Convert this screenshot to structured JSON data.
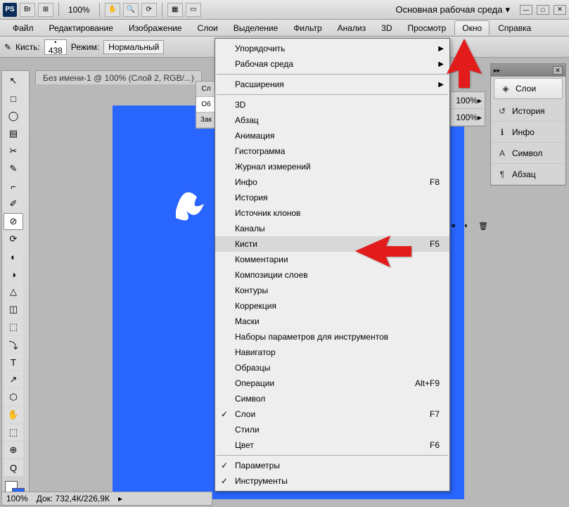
{
  "top": {
    "ps_abbr": "PS",
    "zoom": "100%",
    "workspace_label": "Основная рабочая среда"
  },
  "menus": [
    "Файл",
    "Редактирование",
    "Изображение",
    "Слои",
    "Выделение",
    "Фильтр",
    "Анализ",
    "3D",
    "Просмотр",
    "Окно",
    "Справка"
  ],
  "active_menu_index": 9,
  "options": {
    "brush_label": "Кисть:",
    "brush_size": "438",
    "mode_label": "Режим:",
    "mode_value": "Нормальный"
  },
  "doc_tab": "Без имени-1 @ 100% (Слой 2, RGB/...)",
  "status": {
    "zoom": "100%",
    "doc": "Док: 732,4К/226,9К"
  },
  "dropdown": [
    {
      "type": "item",
      "label": "Упорядочить",
      "submenu": true
    },
    {
      "type": "item",
      "label": "Рабочая среда",
      "submenu": true
    },
    {
      "type": "sep"
    },
    {
      "type": "item",
      "label": "Расширения",
      "submenu": true
    },
    {
      "type": "sep"
    },
    {
      "type": "item",
      "label": "3D"
    },
    {
      "type": "item",
      "label": "Абзац"
    },
    {
      "type": "item",
      "label": "Анимация"
    },
    {
      "type": "item",
      "label": "Гистограмма"
    },
    {
      "type": "item",
      "label": "Журнал измерений"
    },
    {
      "type": "item",
      "label": "Инфо",
      "shortcut": "F8"
    },
    {
      "type": "item",
      "label": "История"
    },
    {
      "type": "item",
      "label": "Источник клонов"
    },
    {
      "type": "item",
      "label": "Каналы"
    },
    {
      "type": "item",
      "label": "Кисти",
      "shortcut": "F5",
      "hover": true
    },
    {
      "type": "item",
      "label": "Комментарии"
    },
    {
      "type": "item",
      "label": "Композиции слоев"
    },
    {
      "type": "item",
      "label": "Контуры"
    },
    {
      "type": "item",
      "label": "Коррекция"
    },
    {
      "type": "item",
      "label": "Маски"
    },
    {
      "type": "item",
      "label": "Наборы параметров для инструментов"
    },
    {
      "type": "item",
      "label": "Навигатор"
    },
    {
      "type": "item",
      "label": "Образцы"
    },
    {
      "type": "item",
      "label": "Операции",
      "shortcut": "Alt+F9"
    },
    {
      "type": "item",
      "label": "Символ"
    },
    {
      "type": "item",
      "label": "Слои",
      "shortcut": "F7",
      "checked": true
    },
    {
      "type": "item",
      "label": "Стили"
    },
    {
      "type": "item",
      "label": "Цвет",
      "shortcut": "F6"
    },
    {
      "type": "sep"
    },
    {
      "type": "item",
      "label": "Параметры",
      "checked": true
    },
    {
      "type": "item",
      "label": "Инструменты",
      "checked": true
    }
  ],
  "side_panel": [
    {
      "label": "Слои",
      "icon": "◈",
      "active": true
    },
    {
      "label": "История",
      "icon": "↺"
    },
    {
      "label": "Инфо",
      "icon": "ℹ"
    },
    {
      "label": "Символ",
      "icon": "A"
    },
    {
      "label": "Абзац",
      "icon": "¶"
    }
  ],
  "right_small": {
    "opacity": "100%",
    "fill": "100%"
  },
  "docked_stub": [
    "Сл",
    "Об",
    "Зак"
  ],
  "tools": [
    "↖",
    "□",
    "◯",
    "▤",
    "✂",
    "✎",
    "⌐",
    "✐",
    "⊘",
    "⟳",
    "◐",
    "◑",
    "△",
    "◫",
    "⬚",
    "⤵",
    "T",
    "↗",
    "⬡",
    "✋",
    "⬚",
    "⊕",
    "Q"
  ]
}
